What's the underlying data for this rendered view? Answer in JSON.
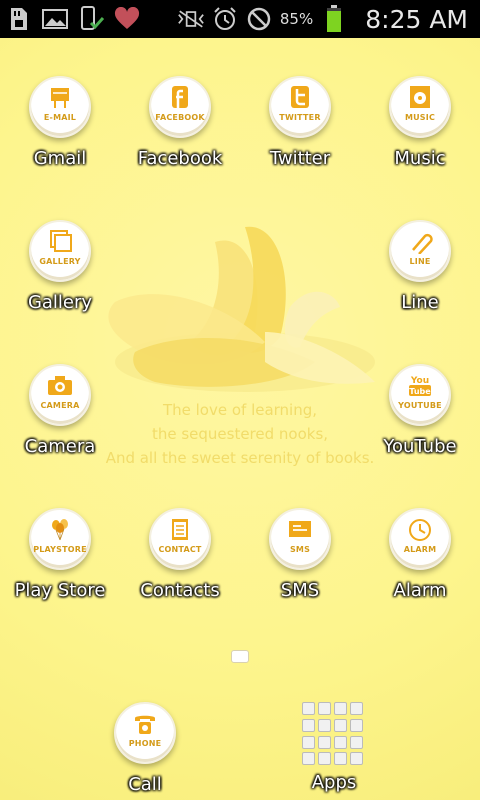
{
  "status_bar": {
    "battery_percent": "85%",
    "time": "8:25 AM",
    "icons": [
      "sd-card-icon",
      "image-icon",
      "phone-check-icon",
      "heart-icon",
      "vibrate-icon",
      "alarm-icon",
      "blocked-icon",
      "battery-icon"
    ]
  },
  "wallpaper": {
    "quote_line1": "The love of learning,",
    "quote_line2": "the sequestered nooks,",
    "quote_line3": "And all the sweet serenity of books."
  },
  "apps": [
    {
      "label": "Gmail",
      "tag": "E-MAIL"
    },
    {
      "label": "Facebook",
      "tag": "FACEBOOK"
    },
    {
      "label": "Twitter",
      "tag": "TWITTER"
    },
    {
      "label": "Music",
      "tag": "MUSIC"
    },
    {
      "label": "Gallery",
      "tag": "GALLERY"
    },
    {
      "label": "Line",
      "tag": "LINE"
    },
    {
      "label": "Camera",
      "tag": "CAMERA"
    },
    {
      "label": "YouTube",
      "tag": "YOUTUBE"
    },
    {
      "label": "Play Store",
      "tag": "PLAYSTORE"
    },
    {
      "label": "Contacts",
      "tag": "CONTACT"
    },
    {
      "label": "SMS",
      "tag": "SMS"
    },
    {
      "label": "Alarm",
      "tag": "ALARM"
    }
  ],
  "dock": {
    "call_label": "Call",
    "call_tag": "PHONE",
    "apps_label": "Apps"
  },
  "colors": {
    "background": "#fdf58d",
    "accent": "#f0a81a",
    "status_bar": "#000000"
  }
}
